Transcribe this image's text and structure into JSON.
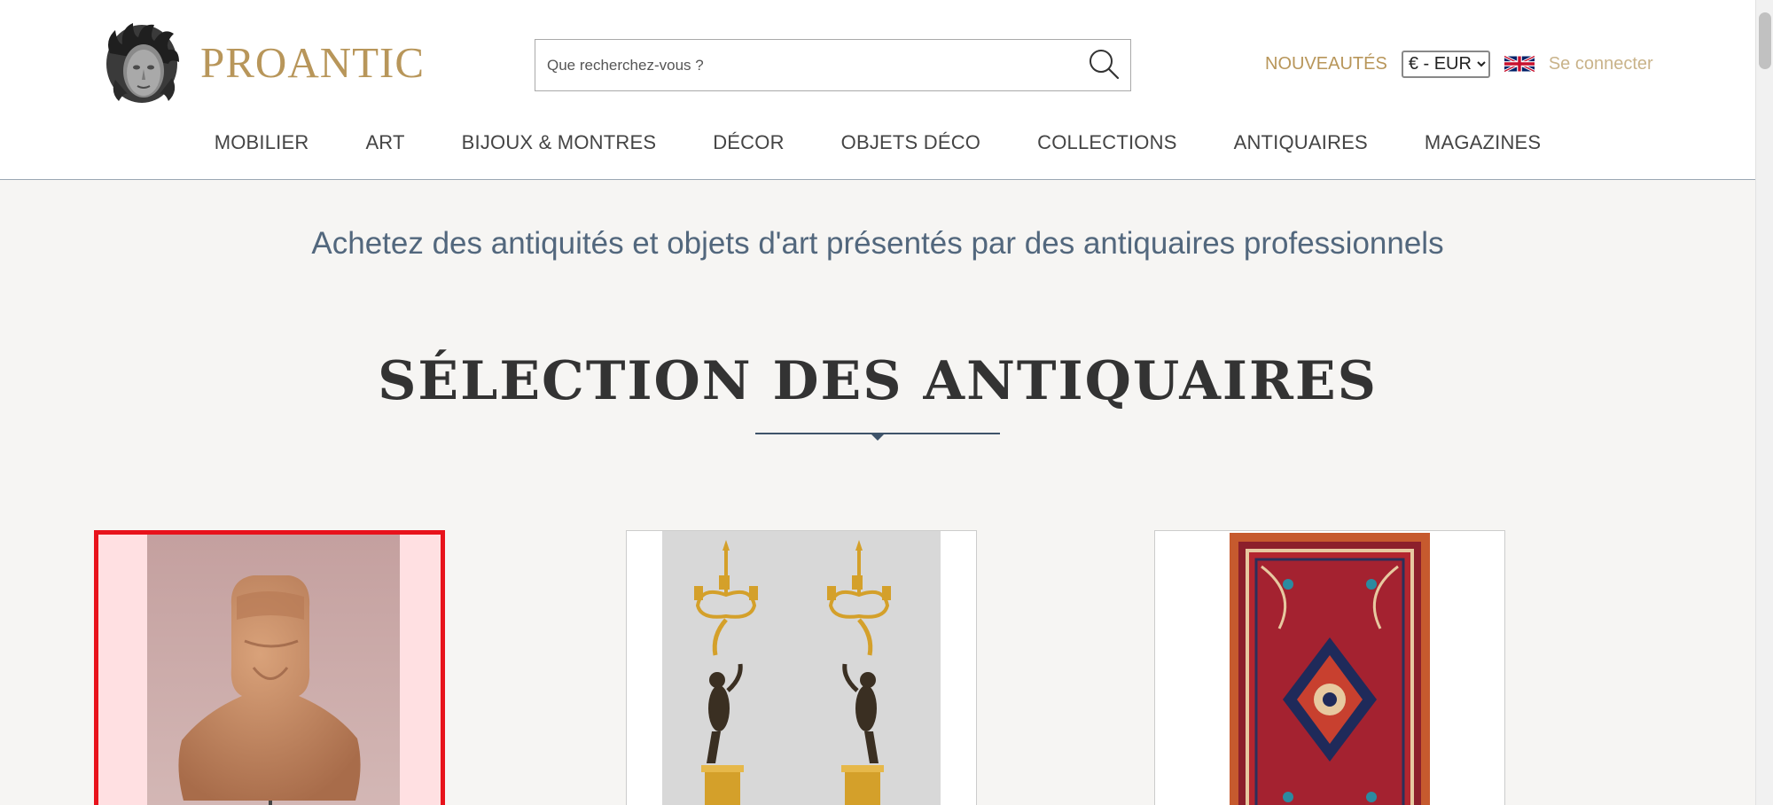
{
  "header": {
    "logo_text": "PROANTIC",
    "search_placeholder": "Que recherchez-vous ?",
    "nouveautes_label": "NOUVEAUTÉS",
    "currency_selected": "€ - EUR",
    "language_flag": "uk-flag-icon",
    "login_label": "Se connecter"
  },
  "nav": {
    "items": [
      {
        "label": "MOBILIER"
      },
      {
        "label": "ART"
      },
      {
        "label": "BIJOUX & MONTRES"
      },
      {
        "label": "DÉCOR"
      },
      {
        "label": "OBJETS DÉCO"
      },
      {
        "label": "COLLECTIONS"
      },
      {
        "label": "ANTIQUAIRES"
      },
      {
        "label": "MAGAZINES"
      }
    ]
  },
  "main": {
    "tagline": "Achetez des antiquités et objets d'art présentés par des antiquaires professionnels",
    "section_title": "SÉLECTION DES ANTIQUAIRES",
    "cards": [
      {
        "image": "terracotta-bust-image",
        "selected": true
      },
      {
        "image": "gilt-bronze-candelabra-image",
        "selected": false
      },
      {
        "image": "persian-rug-image",
        "selected": false
      }
    ]
  },
  "colors": {
    "brand_gold": "#b8965a",
    "tagline_blue": "#52677d",
    "selection_red": "#e8121b"
  }
}
